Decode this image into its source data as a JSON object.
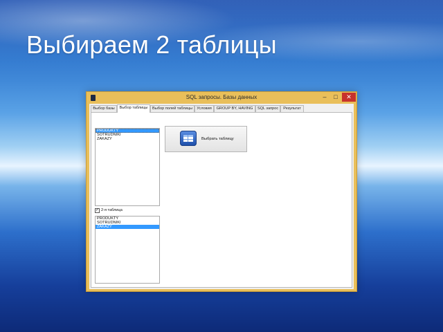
{
  "slide": {
    "title": "Выбираем 2 таблицы"
  },
  "window": {
    "title": "SQL запросы. Базы данных",
    "controls": {
      "minimize": "–",
      "maximize": "□",
      "close": "✕"
    }
  },
  "tabs": [
    {
      "label": "Выбор базы"
    },
    {
      "label": "Выбор таблицы",
      "active": true
    },
    {
      "label": "Выбор полей таблицы"
    },
    {
      "label": "Условия"
    },
    {
      "label": "GROUP BY, HAVING"
    },
    {
      "label": "SQL запрос"
    },
    {
      "label": "Результат"
    }
  ],
  "table_list_1": {
    "items": [
      "PRODUKTY",
      "SOTRUDNIKI",
      "ZAKAZY"
    ],
    "selected": "PRODUKTY"
  },
  "second_table": {
    "label": "2-я таблица",
    "checked": true
  },
  "table_list_2": {
    "items": [
      "PRODUKTY",
      "SOTRUDNIKI",
      "ZAKAZY"
    ],
    "selected": "ZAKAZY"
  },
  "select_button": {
    "label": "Выбрать таблицу",
    "icon": "table-icon"
  },
  "colors": {
    "window_frame": "#e9bf5a",
    "close_button": "#c7322b",
    "selection": "#3399ff"
  }
}
